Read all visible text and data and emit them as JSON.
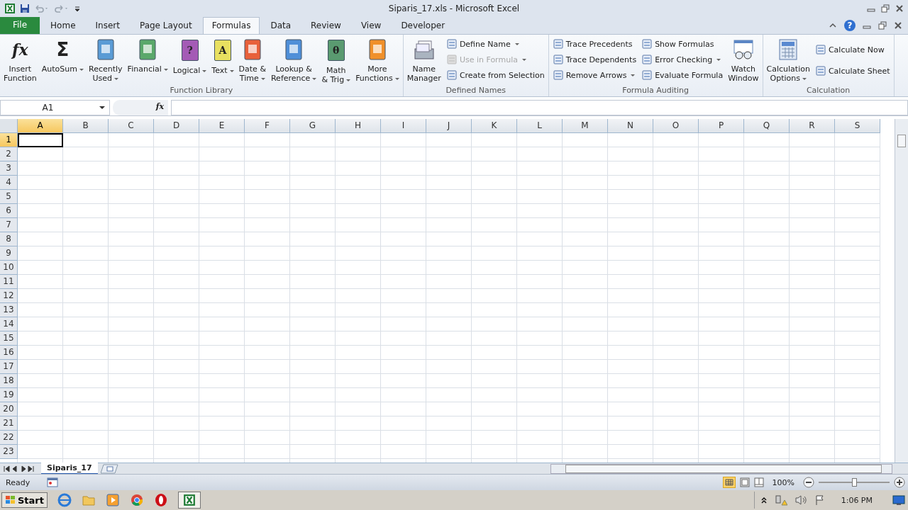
{
  "window": {
    "title": "Siparis_17.xls  -  Microsoft Excel",
    "help_glyph": "?"
  },
  "tabs": [
    {
      "label": "File",
      "kind": "file",
      "selected": false
    },
    {
      "label": "Home",
      "kind": "tab",
      "selected": false
    },
    {
      "label": "Insert",
      "kind": "tab",
      "selected": false
    },
    {
      "label": "Page Layout",
      "kind": "tab",
      "selected": false
    },
    {
      "label": "Formulas",
      "kind": "tab",
      "selected": true
    },
    {
      "label": "Data",
      "kind": "tab",
      "selected": false
    },
    {
      "label": "Review",
      "kind": "tab",
      "selected": false
    },
    {
      "label": "View",
      "kind": "tab",
      "selected": false
    },
    {
      "label": "Developer",
      "kind": "tab",
      "selected": false
    }
  ],
  "ribbon": {
    "groups": [
      {
        "label": "Function Library",
        "items": [
          {
            "kind": "large",
            "label": "Insert\nFunction",
            "dropdown": false,
            "glyph": "fx"
          },
          {
            "kind": "large",
            "label": "AutoSum",
            "dropdown": true,
            "glyph": "Σ"
          },
          {
            "kind": "large",
            "label": "Recently\nUsed",
            "dropdown": true
          },
          {
            "kind": "large",
            "label": "Financial",
            "dropdown": true
          },
          {
            "kind": "large",
            "label": "Logical",
            "dropdown": true,
            "glyph": "?"
          },
          {
            "kind": "large",
            "label": "Text",
            "dropdown": true,
            "glyph": "A"
          },
          {
            "kind": "large",
            "label": "Date &\nTime",
            "dropdown": true
          },
          {
            "kind": "large",
            "label": "Lookup &\nReference",
            "dropdown": true
          },
          {
            "kind": "large",
            "label": "Math\n& Trig",
            "dropdown": true,
            "glyph": "θ"
          },
          {
            "kind": "large",
            "label": "More\nFunctions",
            "dropdown": true
          }
        ]
      },
      {
        "label": "Defined Names",
        "items": [
          {
            "kind": "large",
            "label": "Name\nManager",
            "dropdown": false
          },
          {
            "kind": "stack",
            "items": [
              {
                "label": "Define Name",
                "dropdown": true,
                "disabled": false
              },
              {
                "label": "Use in Formula",
                "dropdown": true,
                "disabled": true
              },
              {
                "label": "Create from Selection",
                "dropdown": false,
                "disabled": false
              }
            ]
          }
        ]
      },
      {
        "label": "Formula Auditing",
        "items": [
          {
            "kind": "stack",
            "items": [
              {
                "label": "Trace Precedents",
                "dropdown": false,
                "disabled": false
              },
              {
                "label": "Trace Dependents",
                "dropdown": false,
                "disabled": false
              },
              {
                "label": "Remove Arrows",
                "dropdown": true,
                "disabled": false
              }
            ]
          },
          {
            "kind": "stack",
            "items": [
              {
                "label": "Show Formulas",
                "dropdown": false,
                "disabled": false
              },
              {
                "label": "Error Checking",
                "dropdown": true,
                "disabled": false
              },
              {
                "label": "Evaluate Formula",
                "dropdown": false,
                "disabled": false
              }
            ]
          },
          {
            "kind": "large",
            "label": "Watch\nWindow",
            "dropdown": false
          }
        ]
      },
      {
        "label": "Calculation",
        "items": [
          {
            "kind": "large",
            "label": "Calculation\nOptions",
            "dropdown": true
          },
          {
            "kind": "stack",
            "items": [
              {
                "label": "Calculate Now",
                "dropdown": false,
                "disabled": false
              },
              {
                "label": "Calculate Sheet",
                "dropdown": false,
                "disabled": false
              }
            ]
          }
        ]
      }
    ]
  },
  "formula_bar": {
    "name_box": "A1",
    "fx_label": "fx"
  },
  "sheet": {
    "columns": [
      {
        "label": "A",
        "selected": true
      },
      {
        "label": "B",
        "selected": false
      },
      {
        "label": "C",
        "selected": false
      },
      {
        "label": "D",
        "selected": false
      },
      {
        "label": "E",
        "selected": false
      },
      {
        "label": "F",
        "selected": false
      },
      {
        "label": "G",
        "selected": false
      },
      {
        "label": "H",
        "selected": false
      },
      {
        "label": "I",
        "selected": false
      },
      {
        "label": "J",
        "selected": false
      },
      {
        "label": "K",
        "selected": false
      },
      {
        "label": "L",
        "selected": false
      },
      {
        "label": "M",
        "selected": false
      },
      {
        "label": "N",
        "selected": false
      },
      {
        "label": "O",
        "selected": false
      },
      {
        "label": "P",
        "selected": false
      },
      {
        "label": "Q",
        "selected": false
      },
      {
        "label": "R",
        "selected": false
      },
      {
        "label": "S",
        "selected": false
      }
    ],
    "rows": [
      {
        "label": "1",
        "selected": true
      },
      {
        "label": "2",
        "selected": false
      },
      {
        "label": "3",
        "selected": false
      },
      {
        "label": "4",
        "selected": false
      },
      {
        "label": "5",
        "selected": false
      },
      {
        "label": "6",
        "selected": false
      },
      {
        "label": "7",
        "selected": false
      },
      {
        "label": "8",
        "selected": false
      },
      {
        "label": "9",
        "selected": false
      },
      {
        "label": "10",
        "selected": false
      },
      {
        "label": "11",
        "selected": false
      },
      {
        "label": "12",
        "selected": false
      },
      {
        "label": "13",
        "selected": false
      },
      {
        "label": "14",
        "selected": false
      },
      {
        "label": "15",
        "selected": false
      },
      {
        "label": "16",
        "selected": false
      },
      {
        "label": "17",
        "selected": false
      },
      {
        "label": "18",
        "selected": false
      },
      {
        "label": "19",
        "selected": false
      },
      {
        "label": "20",
        "selected": false
      },
      {
        "label": "21",
        "selected": false
      },
      {
        "label": "22",
        "selected": false
      },
      {
        "label": "23",
        "selected": false
      }
    ]
  },
  "sheet_tabs": [
    {
      "label": "Siparis_17",
      "selected": true
    }
  ],
  "status_bar": {
    "status": "Ready",
    "zoom": "100%",
    "zoom_slider": {
      "level": 0.5
    }
  },
  "taskbar": {
    "start": "Start",
    "clock": "1:06 PM"
  }
}
